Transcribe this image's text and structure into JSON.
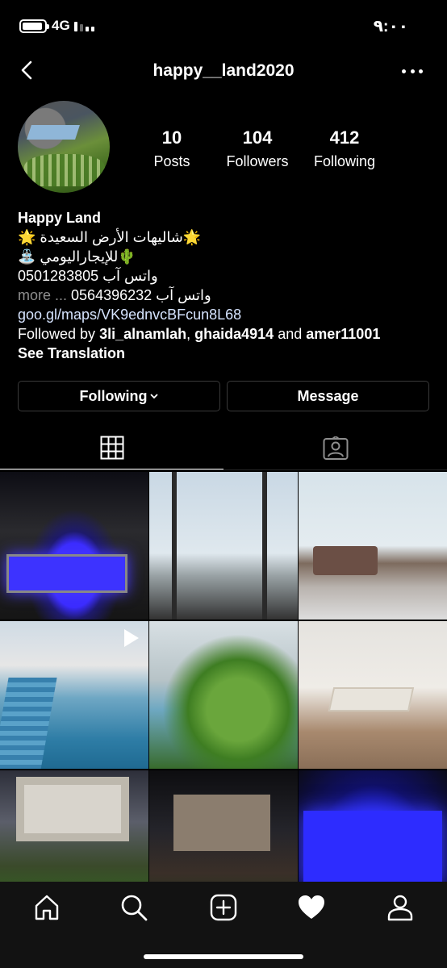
{
  "status_bar": {
    "network": "4G",
    "time": "٩:٠٠"
  },
  "header": {
    "username": "happy__land2020"
  },
  "stats": {
    "posts": {
      "count": "10",
      "label": "Posts"
    },
    "followers": {
      "count": "104",
      "label": "Followers"
    },
    "following": {
      "count": "412",
      "label": "Following"
    }
  },
  "bio": {
    "name": "Happy Land",
    "line1": "🌟شاليهات الأرض السعيدة 🌟",
    "line2": "🌵للإيجاراليومي ⛲",
    "line3": "واتس آب 0501283805",
    "line4_more": "more ...",
    "line4": "واتس آب 0564396232",
    "website": "goo.gl/maps/VK9ednvcBFcun8L68",
    "followed_by_prefix": "Followed by ",
    "followed_by_user1": "3li_alnamlah",
    "followed_by_sep": ", ",
    "followed_by_user2": "ghaida4914",
    "followed_by_and": " and ",
    "followed_by_user3": "amer11001",
    "see_translation": "See Translation"
  },
  "buttons": {
    "following": "Following",
    "message": "Message"
  },
  "tabs": [
    {
      "name": "grid",
      "icon": "grid-icon",
      "active": true
    },
    {
      "name": "tagged",
      "icon": "tagged-person-icon",
      "active": false
    }
  ],
  "posts": [
    {
      "subject": "night pool villa",
      "video": false
    },
    {
      "subject": "glass window view",
      "video": false
    },
    {
      "subject": "living room sofa",
      "video": false
    },
    {
      "subject": "outdoor pool",
      "video": true
    },
    {
      "subject": "plants near pool",
      "video": false
    },
    {
      "subject": "dining room",
      "video": false
    },
    {
      "subject": "villa lawn evening",
      "video": false
    },
    {
      "subject": "villa night exterior",
      "video": false
    },
    {
      "subject": "blue lit pool",
      "video": false
    }
  ],
  "bottom_nav": [
    "home-icon",
    "search-icon",
    "add-post-icon",
    "activity-heart-icon",
    "profile-icon"
  ]
}
